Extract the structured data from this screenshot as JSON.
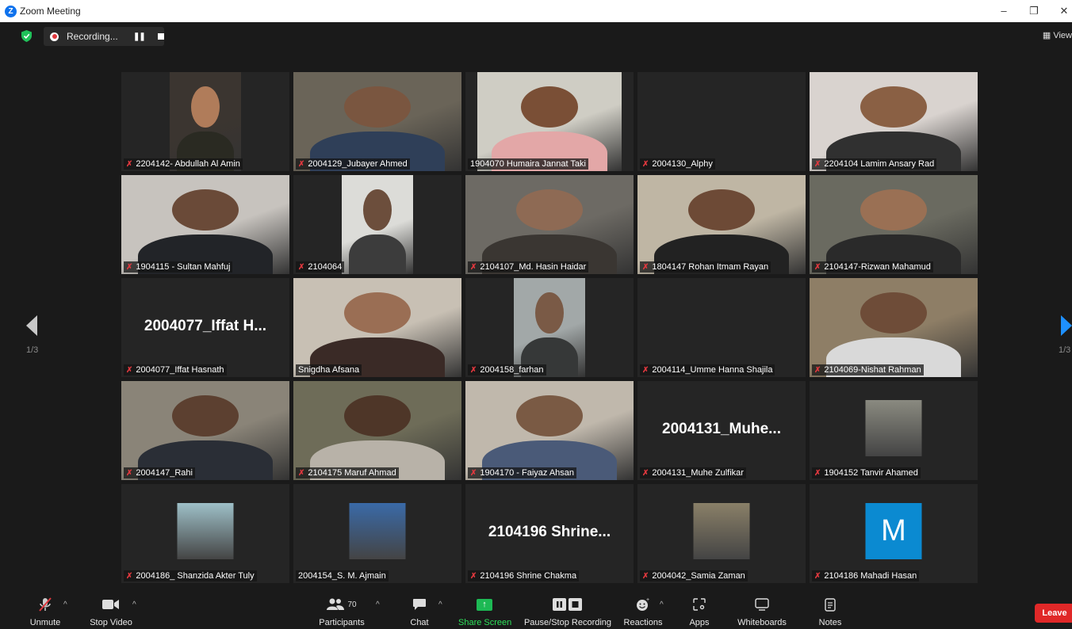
{
  "window": {
    "title": "Zoom Meeting",
    "logo": "Z",
    "minimize": "–",
    "restore": "❐",
    "close": "✕"
  },
  "recording": {
    "label": "Recording...",
    "pause": "❚❚"
  },
  "view_button": {
    "label": "View"
  },
  "pagination": {
    "left": "1/3",
    "right": "1/3"
  },
  "participants": [
    {
      "name": "2204142- Abdullah Al Amin",
      "muted": true,
      "type": "video",
      "c1": "#3b3530",
      "c2": "#b07c5a",
      "c3": "#2a2a22",
      "vw": 0.42
    },
    {
      "name": "2004129_Jubayer Ahmed",
      "muted": true,
      "type": "video",
      "c1": "#6a6458",
      "c2": "#7a5640",
      "c3": "#2f3f58",
      "vw": 1.0
    },
    {
      "name": "1904070 Humaira Jannat Taki",
      "muted": false,
      "type": "video",
      "c1": "#cfcdc4",
      "c2": "#7a4f36",
      "c3": "#e3a7a7",
      "vw": 0.86
    },
    {
      "name": "2004130_Alphy",
      "muted": true,
      "type": "blank"
    },
    {
      "name": "2204104 Lamim Ansary Rad",
      "muted": true,
      "type": "video",
      "c1": "#d9d3cf",
      "c2": "#8a6044",
      "c3": "#303030",
      "vw": 1.0
    },
    {
      "name": "1904115 - Sultan Mahfuj",
      "muted": true,
      "type": "video",
      "c1": "#c7c3be",
      "c2": "#6a4a38",
      "c3": "#222428",
      "vw": 1.0
    },
    {
      "name": "2104064",
      "muted": true,
      "type": "video",
      "c1": "#dcdcd8",
      "c2": "#6c4e3c",
      "c3": "#3c3c3c",
      "vw": 0.42
    },
    {
      "name": "2104107_Md. Hasin Haidar",
      "muted": true,
      "type": "video",
      "c1": "#6d6a64",
      "c2": "#8e6a54",
      "c3": "#3a3632",
      "vw": 1.0
    },
    {
      "name": "1804147 Rohan Itmam Rayan",
      "muted": true,
      "type": "video",
      "c1": "#bfb6a4",
      "c2": "#6d4a36",
      "c3": "#222222",
      "vw": 1.0
    },
    {
      "name": "2104147-Rizwan Mahamud",
      "muted": true,
      "type": "video",
      "c1": "#6a6a60",
      "c2": "#9a7054",
      "c3": "#2a2a2a",
      "vw": 1.0
    },
    {
      "name": "2004077_Iffat Hasnath",
      "muted": true,
      "type": "name",
      "big": "2004077_Iffat  H..."
    },
    {
      "name": "Snigdha Afsana",
      "muted": false,
      "type": "video",
      "c1": "#c8c0b4",
      "c2": "#9a6e54",
      "c3": "#3a2a26",
      "vw": 1.0,
      "active": true
    },
    {
      "name": "2004158_farhan",
      "muted": true,
      "type": "video",
      "c1": "#a2a8a8",
      "c2": "#7a5a46",
      "c3": "#363838",
      "vw": 0.42
    },
    {
      "name": "2004114_Umme Hanna Shajila",
      "muted": true,
      "type": "blank"
    },
    {
      "name": "2104069-Nishat Rahman",
      "muted": true,
      "type": "video",
      "c1": "#8e7e66",
      "c2": "#6e4c38",
      "c3": "#d9d9d9",
      "vw": 1.0
    },
    {
      "name": "2004147_Rahi",
      "muted": true,
      "type": "video",
      "c1": "#8a8478",
      "c2": "#5c4030",
      "c3": "#2a2e36",
      "vw": 1.0
    },
    {
      "name": "2104175 Maruf Ahmad",
      "muted": true,
      "type": "video",
      "c1": "#6e6c58",
      "c2": "#4e3628",
      "c3": "#b8b2a8",
      "vw": 1.0
    },
    {
      "name": "1904170 - Faiyaz Ahsan",
      "muted": true,
      "type": "video",
      "c1": "#c0b8ac",
      "c2": "#7a5a44",
      "c3": "#4a5a78",
      "vw": 1.0
    },
    {
      "name": "2004131_Muhe Zulfikar",
      "muted": true,
      "type": "name",
      "big": "2004131_Muhe..."
    },
    {
      "name": "1904152 Tanvir Ahamed",
      "muted": true,
      "type": "avatar",
      "ac": "#8a8a80"
    },
    {
      "name": "2004186_ Shanzida Akter Tuly",
      "muted": true,
      "type": "avatar",
      "ac": "#9ec0c8"
    },
    {
      "name": "2004154_S. M. Ajmain",
      "muted": false,
      "type": "avatar",
      "ac": "#3a6aa8"
    },
    {
      "name": "2104196 Shrine Chakma",
      "muted": true,
      "type": "name",
      "big": "2104196  Shrine..."
    },
    {
      "name": "2004042_Samia Zaman",
      "muted": true,
      "type": "avatar",
      "ac": "#8a8068"
    },
    {
      "name": "2104186 Mahadi Hasan",
      "muted": true,
      "type": "letter",
      "letter": "M"
    }
  ],
  "toolbar": {
    "unmute": "Unmute",
    "stop_video": "Stop Video",
    "participants": "Participants",
    "participants_count": "70",
    "chat": "Chat",
    "share_screen": "Share Screen",
    "pause_stop_recording": "Pause/Stop Recording",
    "reactions": "Reactions",
    "apps": "Apps",
    "whiteboards": "Whiteboards",
    "notes": "Notes",
    "leave": "Leave"
  },
  "colors": {
    "share_green": "#2ee05a",
    "leave_red": "#e02828",
    "active_speaker": "#c4e34a",
    "muted_red": "#e0383e"
  }
}
